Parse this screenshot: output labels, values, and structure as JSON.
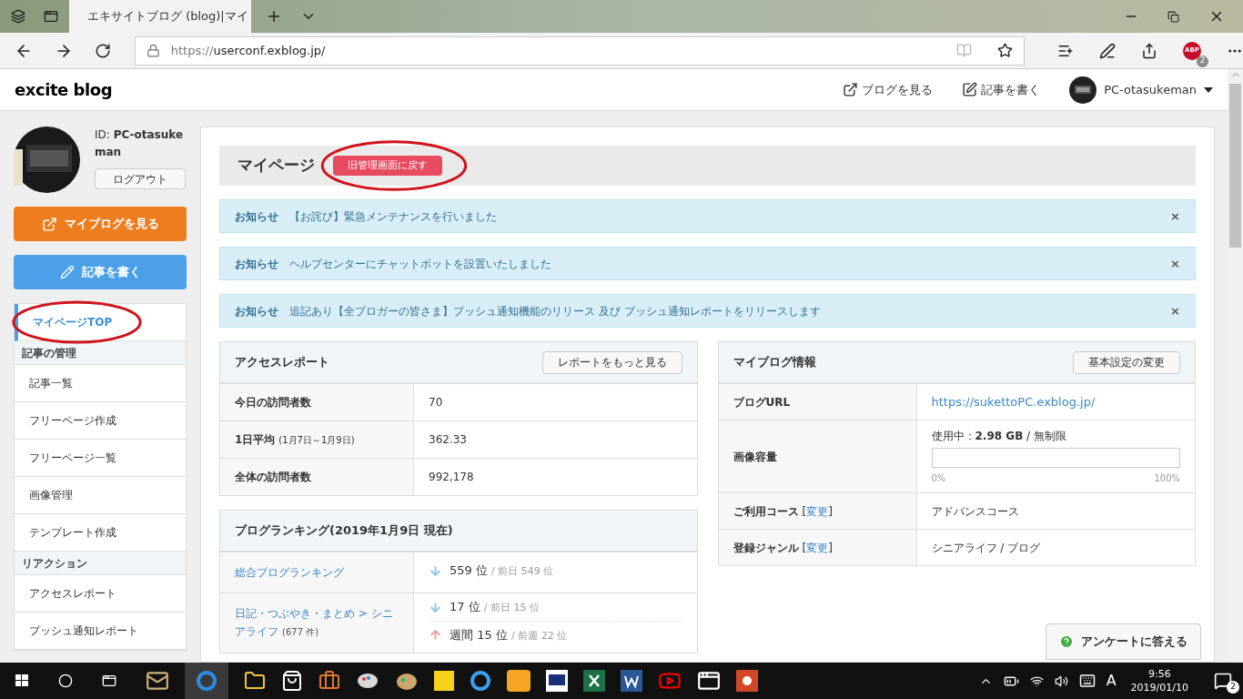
{
  "browser": {
    "tabs": [
      {
        "title": "エキサイトブログ (blog)|マイ",
        "selected": true
      }
    ],
    "url_scheme": "https://",
    "url_host": "userconf.exblog.jp/",
    "abp_label": "ABP",
    "abp_badge": "2"
  },
  "site": {
    "logo_pre": "e",
    "logo_x": "x",
    "logo_post": "cite blog",
    "header_links": [
      "ブログを見る",
      "記事を書く"
    ],
    "user": "PC-otasukeman"
  },
  "sidebar": {
    "id_label": "ID:",
    "id_value": "PC-otasukeman",
    "logout": "ログアウト",
    "my_blog_button": "マイブログを見る",
    "write_button": "記事を書く",
    "menu": [
      {
        "kind": "item",
        "label": "マイページTOP",
        "selected": true
      },
      {
        "kind": "heading",
        "label": "記事の管理"
      },
      {
        "kind": "item",
        "label": "記事一覧",
        "selected": false
      },
      {
        "kind": "item",
        "label": "フリーページ作成",
        "selected": false
      },
      {
        "kind": "item",
        "label": "フリーページ一覧",
        "selected": false
      },
      {
        "kind": "item",
        "label": "画像管理",
        "selected": false
      },
      {
        "kind": "item",
        "label": "テンプレート作成",
        "selected": false
      },
      {
        "kind": "heading",
        "label": "リアクション"
      },
      {
        "kind": "item",
        "label": "アクセスレポート",
        "selected": false
      },
      {
        "kind": "item",
        "label": "プッシュ通知レポート",
        "selected": false
      }
    ]
  },
  "main": {
    "title": "マイページ",
    "old_button": "旧管理画面に戻す",
    "notices": [
      {
        "label": "お知らせ",
        "text": "【お詫び】緊急メンテナンスを行いました",
        "close": "×"
      },
      {
        "label": "お知らせ",
        "text": "ヘルプセンターにチャットボットを設置いたしました",
        "close": "×"
      },
      {
        "label": "お知らせ",
        "text": "追記あり【全ブロガーの皆さま】プッシュ通知機能のリリース 及び プッシュ通知レポートをリリースします",
        "close": "×"
      }
    ],
    "access_report": {
      "title": "アクセスレポート",
      "button": "レポートをもっと見る",
      "rows": [
        {
          "label": "今日の訪問者数",
          "value": "70"
        },
        {
          "label": "1日平均",
          "note": "(1月7日～1月9日)",
          "value": "362.33"
        },
        {
          "label": "全体の訪問者数",
          "value": "992,178"
        }
      ]
    },
    "ranking": {
      "title": "ブログランキング(2019年1月9日 現在)",
      "rows": [
        {
          "name": "総合ブログランキング",
          "entries": [
            {
              "kind": "down",
              "rank": "559 位",
              "prev": "/ 前日 549 位"
            }
          ]
        },
        {
          "name": "日記・つぶやき・まとめ > シニアライフ",
          "count": "(677 件)",
          "entries": [
            {
              "kind": "down",
              "rank": "17 位",
              "prev": "/ 前日 15 位"
            },
            {
              "kind": "up",
              "rank": "週間 15 位",
              "prev": "/ 前週 22 位"
            }
          ]
        }
      ]
    },
    "blog_info": {
      "title": "マイブログ情報",
      "button": "基本設定の変更",
      "rows": [
        {
          "kind": "url",
          "label": "ブログURL",
          "value": "https://sukettoPC.exblog.jp/"
        },
        {
          "kind": "storage",
          "label": "画像容量",
          "value": "使用中：**2.98 GB** / 無制限",
          "level": 0,
          "min": "0%",
          "max": "100%"
        },
        {
          "kind": "text",
          "label": "ご利用コース",
          "bracket_open": "[",
          "link": "変更",
          "bracket_close": "]",
          "value": "アドバンスコース"
        },
        {
          "kind": "text",
          "label": "登録ジャンル",
          "bracket_open": "[",
          "link": "変更",
          "bracket_close": "]",
          "value": "シニアライフ / ブログ"
        }
      ]
    },
    "survey_button": "アンケートに答える"
  },
  "taskbar": {
    "time": "9:56",
    "date": "2019/01/10",
    "ime": "A",
    "notifications": "2"
  }
}
